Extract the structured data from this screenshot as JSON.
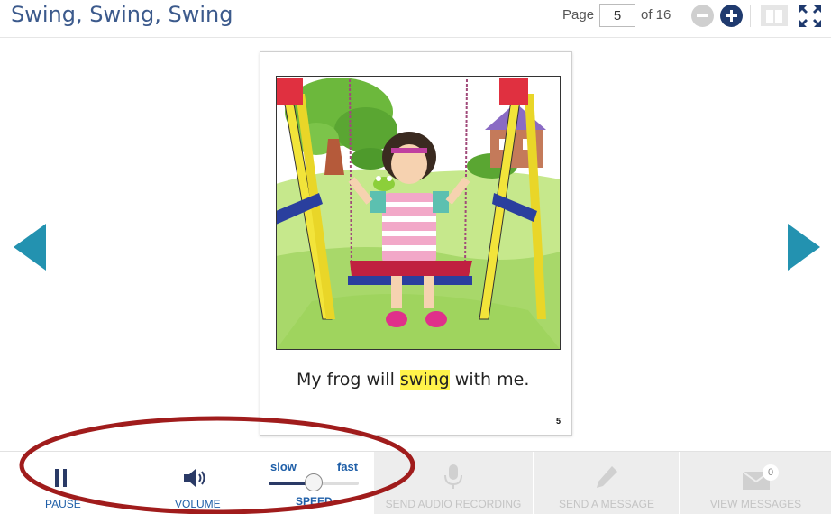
{
  "header": {
    "title": "Swing, Swing, Swing",
    "page_label": "Page",
    "page_value": "5",
    "page_of": "of 16"
  },
  "book": {
    "sentence_before": "My frog will ",
    "sentence_highlight": "swing",
    "sentence_after": " with me.",
    "page_number": "5"
  },
  "controls": {
    "pause_label": "PAUSE",
    "volume_label": "VOLUME",
    "speed_slow": "slow",
    "speed_fast": "fast",
    "speed_label": "SPEED",
    "speed_level": 0.5,
    "send_audio_label": "SEND AUDIO RECORDING",
    "send_message_label": "SEND A MESSAGE",
    "view_messages_label": "VIEW MESSAGES",
    "message_count": "0"
  },
  "colors": {
    "title": "#3c5a8c",
    "nav_arrow": "#2392b0",
    "control_blue": "#1f5fa8",
    "highlight": "#fff34a",
    "annotation": "#a01c1c"
  },
  "icons": {
    "zoom_out": "minus-circle-icon",
    "zoom_in": "plus-circle-icon",
    "book_view": "open-book-icon",
    "fullscreen": "fullscreen-icon",
    "prev": "triangle-left-icon",
    "next": "triangle-right-icon",
    "pause": "pause-icon",
    "volume": "speaker-icon",
    "microphone": "microphone-icon",
    "pencil": "pencil-icon",
    "envelope": "envelope-icon"
  }
}
